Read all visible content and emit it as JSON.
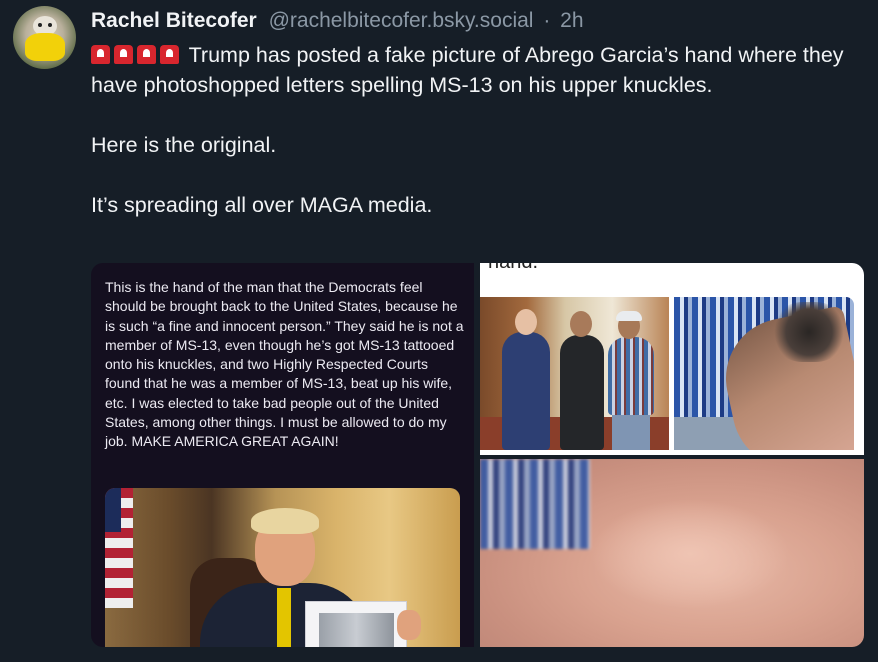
{
  "post": {
    "display_name": "Rachel Bitecofer",
    "handle": "@rachelbitecofer.bsky.social",
    "separator": "·",
    "timestamp": "2h",
    "text_line1": "Trump has posted a fake picture of Abrego Garcia’s hand where they have photoshopped letters spelling MS-13 on his upper knuckles.",
    "text_line2": "Here is the original.",
    "text_line3": "It’s spreading all over MAGA media.",
    "leading_emoji_icons": [
      "siren-icon",
      "siren-icon",
      "siren-icon",
      "siren-icon"
    ]
  },
  "media": {
    "left_caption": "This is the hand of the man that the Democrats feel should be brought back to the United States, because he is such “a fine and innocent person.” They said he is not a member of MS-13, even though he’s got MS-13 tattooed onto his knuckles, and two Highly Respected Courts found that he was a member of MS-13, beat up his wife, etc. I was elected to take bad people out of the United States, among other things. I must be allowed to do my job. MAKE AMERICA GREAT AGAIN!",
    "right_top_cut_text": "hand."
  }
}
